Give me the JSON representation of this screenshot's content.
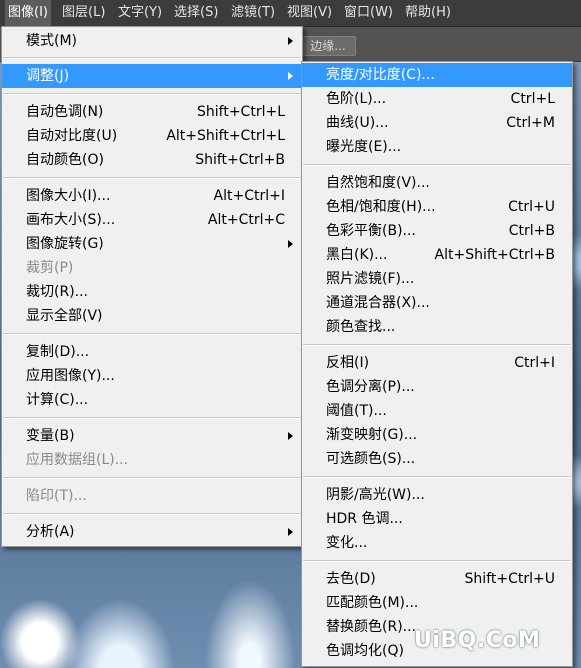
{
  "menubar": {
    "items": [
      "图像(I)",
      "图层(L)",
      "文字(Y)",
      "选择(S)",
      "滤镜(T)",
      "视图(V)",
      "窗口(W)",
      "帮助(H)"
    ]
  },
  "options_bar": {
    "edge_button": "边缘..."
  },
  "image_menu": {
    "items": [
      {
        "label": "模式(M)",
        "shortcut": "",
        "submenu": true
      },
      {
        "label": "调整(J)",
        "shortcut": "",
        "submenu": true,
        "highlighted": true
      },
      {
        "label": "自动色调(N)",
        "shortcut": "Shift+Ctrl+L"
      },
      {
        "label": "自动对比度(U)",
        "shortcut": "Alt+Shift+Ctrl+L"
      },
      {
        "label": "自动颜色(O)",
        "shortcut": "Shift+Ctrl+B"
      },
      {
        "label": "图像大小(I)...",
        "shortcut": "Alt+Ctrl+I"
      },
      {
        "label": "画布大小(S)...",
        "shortcut": "Alt+Ctrl+C"
      },
      {
        "label": "图像旋转(G)",
        "shortcut": "",
        "submenu": true
      },
      {
        "label": "裁剪(P)",
        "shortcut": "",
        "disabled": true
      },
      {
        "label": "裁切(R)...",
        "shortcut": ""
      },
      {
        "label": "显示全部(V)",
        "shortcut": ""
      },
      {
        "label": "复制(D)...",
        "shortcut": ""
      },
      {
        "label": "应用图像(Y)...",
        "shortcut": ""
      },
      {
        "label": "计算(C)...",
        "shortcut": ""
      },
      {
        "label": "变量(B)",
        "shortcut": "",
        "submenu": true
      },
      {
        "label": "应用数据组(L)...",
        "shortcut": "",
        "disabled": true
      },
      {
        "label": "陷印(T)...",
        "shortcut": "",
        "disabled": true
      },
      {
        "label": "分析(A)",
        "shortcut": "",
        "submenu": true
      }
    ]
  },
  "adjust_submenu": {
    "items": [
      {
        "label": "亮度/对比度(C)...",
        "shortcut": "",
        "highlighted": true
      },
      {
        "label": "色阶(L)...",
        "shortcut": "Ctrl+L"
      },
      {
        "label": "曲线(U)...",
        "shortcut": "Ctrl+M"
      },
      {
        "label": "曝光度(E)...",
        "shortcut": ""
      },
      {
        "label": "自然饱和度(V)...",
        "shortcut": ""
      },
      {
        "label": "色相/饱和度(H)...",
        "shortcut": "Ctrl+U"
      },
      {
        "label": "色彩平衡(B)...",
        "shortcut": "Ctrl+B"
      },
      {
        "label": "黑白(K)...",
        "shortcut": "Alt+Shift+Ctrl+B"
      },
      {
        "label": "照片滤镜(F)...",
        "shortcut": ""
      },
      {
        "label": "通道混合器(X)...",
        "shortcut": ""
      },
      {
        "label": "颜色查找...",
        "shortcut": ""
      },
      {
        "label": "反相(I)",
        "shortcut": "Ctrl+I"
      },
      {
        "label": "色调分离(P)...",
        "shortcut": ""
      },
      {
        "label": "阈值(T)...",
        "shortcut": ""
      },
      {
        "label": "渐变映射(G)...",
        "shortcut": ""
      },
      {
        "label": "可选颜色(S)...",
        "shortcut": ""
      },
      {
        "label": "阴影/高光(W)...",
        "shortcut": ""
      },
      {
        "label": "HDR 色调...",
        "shortcut": ""
      },
      {
        "label": "变化...",
        "shortcut": ""
      },
      {
        "label": "去色(D)",
        "shortcut": "Shift+Ctrl+U"
      },
      {
        "label": "匹配颜色(M)...",
        "shortcut": ""
      },
      {
        "label": "替换颜色(R)...",
        "shortcut": ""
      },
      {
        "label": "色调均化(Q)",
        "shortcut": ""
      }
    ]
  },
  "watermark": "UiBQ.CoM"
}
